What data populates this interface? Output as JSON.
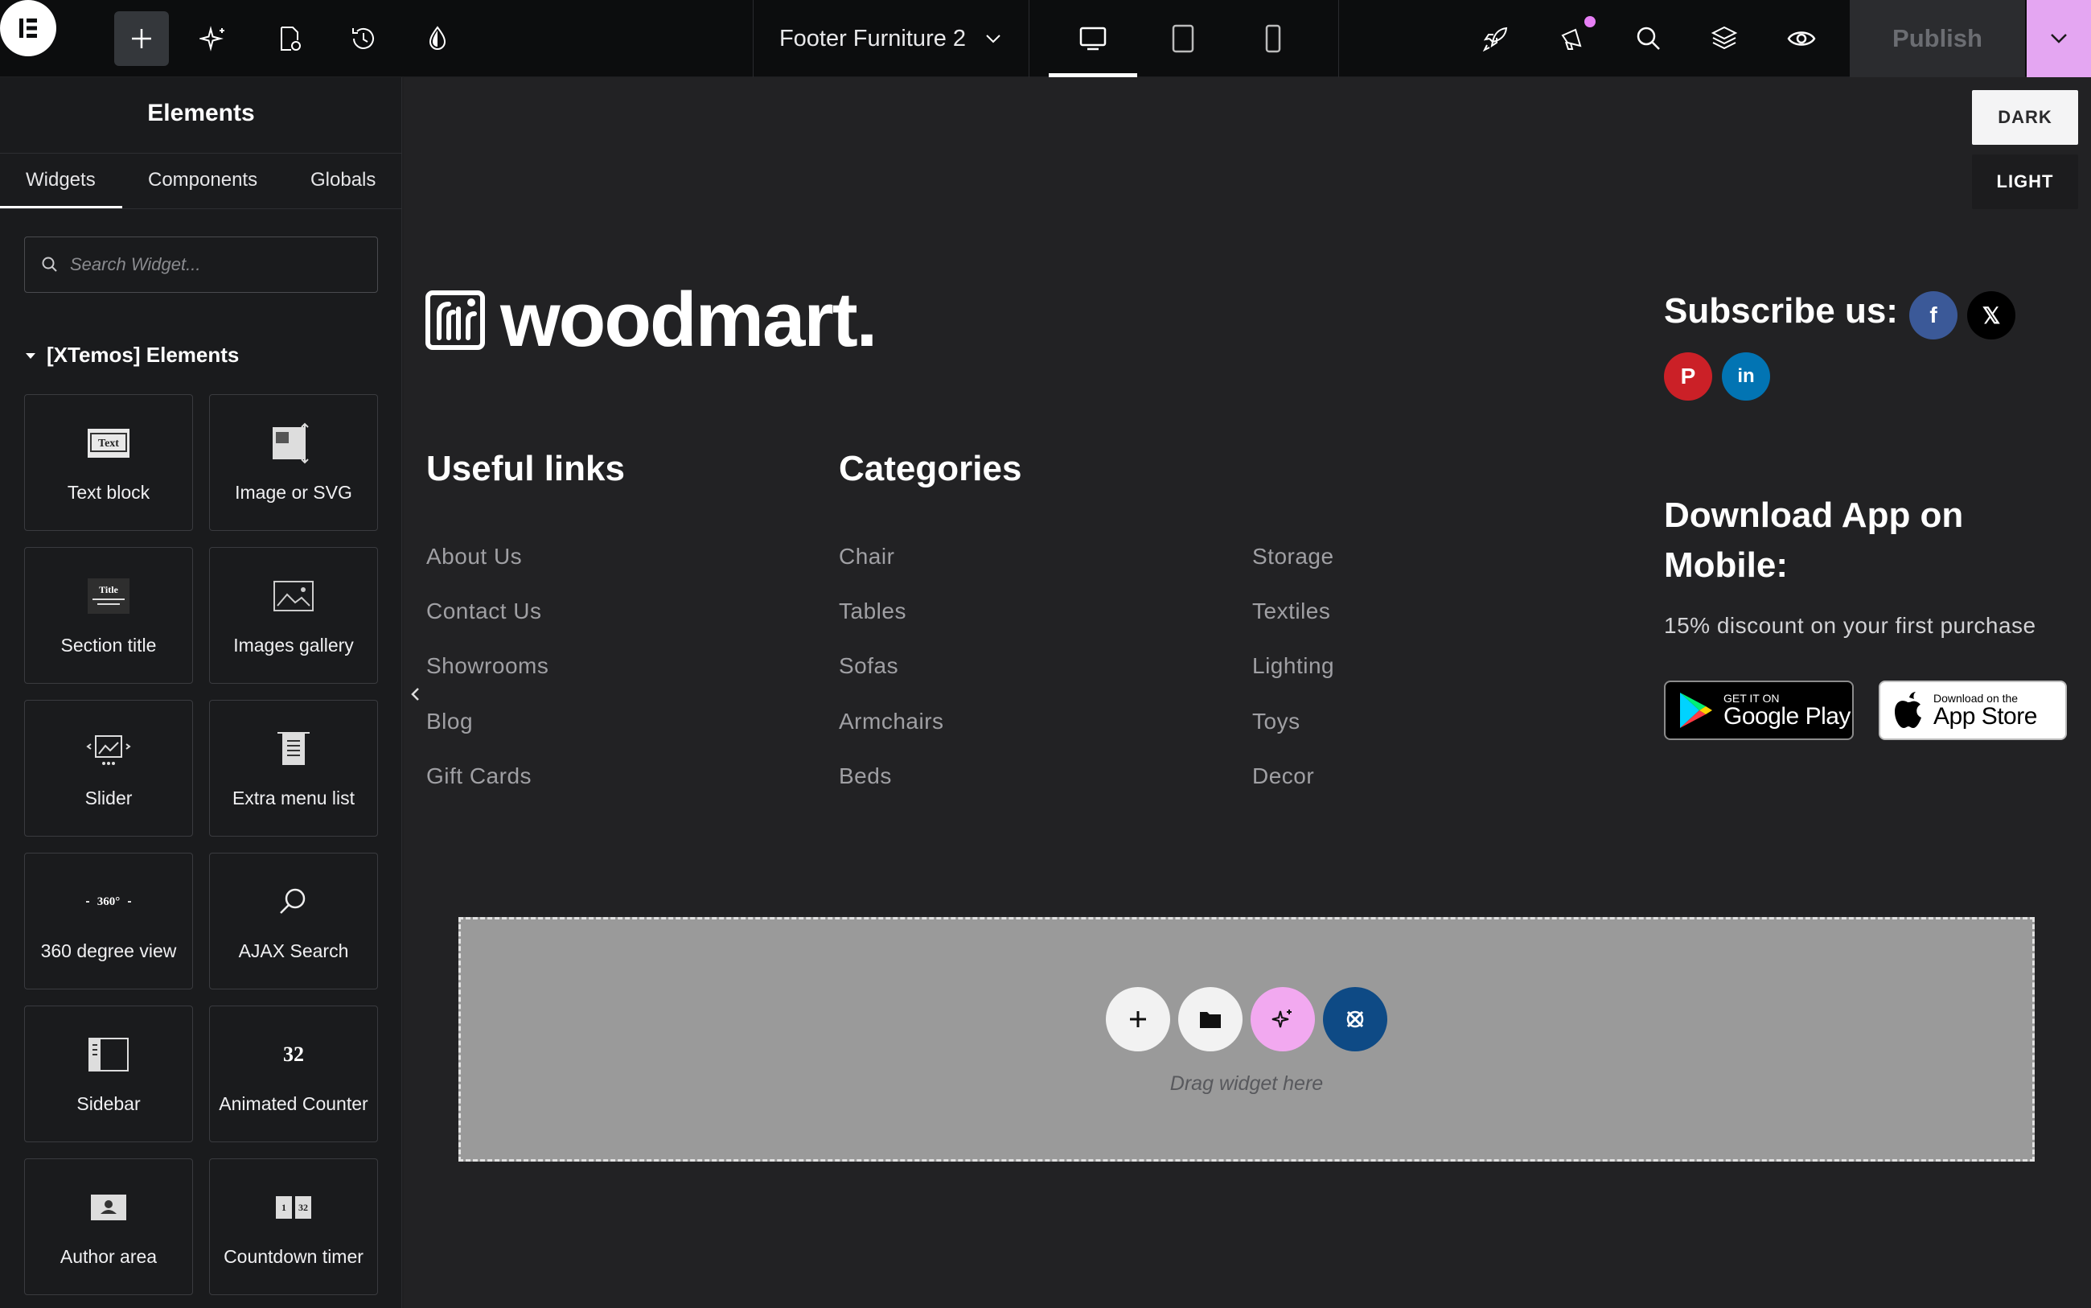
{
  "toolbar": {
    "doc_title": "Footer Furniture 2",
    "publish_label": "Publish",
    "icons": [
      "elementor-logo-icon",
      "plus-icon",
      "ai-sparkle-icon",
      "page-settings-icon",
      "history-icon",
      "site-settings-icon",
      "desktop-icon",
      "tablet-icon",
      "mobile-icon",
      "rocket-icon",
      "announcement-icon",
      "search-icon",
      "structure-icon",
      "preview-eye-icon",
      "chevron-down-icon"
    ],
    "accent_color": "#e4a6f2"
  },
  "panel": {
    "title": "Elements",
    "tabs": [
      "Widgets",
      "Components",
      "Globals"
    ],
    "active_tab": "Widgets",
    "search_placeholder": "Search Widget...",
    "category": "[XTemos] Elements",
    "widgets": [
      {
        "label": "Text block",
        "icon": "text-block-icon"
      },
      {
        "label": "Image or SVG",
        "icon": "image-svg-icon"
      },
      {
        "label": "Section title",
        "icon": "section-title-icon"
      },
      {
        "label": "Images gallery",
        "icon": "images-gallery-icon"
      },
      {
        "label": "Slider",
        "icon": "slider-icon"
      },
      {
        "label": "Extra menu list",
        "icon": "extra-menu-list-icon"
      },
      {
        "label": "360 degree view",
        "icon": "360-view-icon"
      },
      {
        "label": "AJAX Search",
        "icon": "ajax-search-icon"
      },
      {
        "label": "Sidebar",
        "icon": "sidebar-icon"
      },
      {
        "label": "Animated Counter",
        "icon": "animated-counter-icon"
      },
      {
        "label": "Author area",
        "icon": "author-area-icon"
      },
      {
        "label": "Countdown timer",
        "icon": "countdown-timer-icon"
      }
    ],
    "icon_texts": {
      "text": "Text",
      "title": "Title",
      "deg": "360°",
      "count": "32",
      "cd1": "1",
      "cd2": "32"
    }
  },
  "canvas": {
    "modes": [
      "DARK",
      "LIGHT"
    ],
    "brand": "woodmart.",
    "useful_links": {
      "heading": "Useful links",
      "items": [
        "About Us",
        "Contact Us",
        "Showrooms",
        "Blog",
        "Gift Cards"
      ]
    },
    "categories": {
      "heading": "Categories",
      "col1": [
        "Chair",
        "Tables",
        "Sofas",
        "Armchairs",
        "Beds"
      ],
      "col2": [
        "Storage",
        "Textiles",
        "Lighting",
        "Toys",
        "Decor"
      ]
    },
    "subscribe": {
      "heading": "Subscribe us:",
      "socials": [
        {
          "name": "facebook",
          "glyph": "f",
          "color": "#3b5998"
        },
        {
          "name": "x-twitter",
          "glyph": "𝕏",
          "color": "#000000"
        },
        {
          "name": "pinterest",
          "glyph": "P",
          "color": "#cb2027"
        },
        {
          "name": "linkedin",
          "glyph": "in",
          "color": "#0274b3"
        }
      ]
    },
    "download": {
      "heading": "Download App on Mobile:",
      "subtext": "15% discount on your first purchase",
      "google_small": "GET IT ON",
      "google_big": "Google Play",
      "apple_small": "Download on the",
      "apple_big": "App Store"
    },
    "dropzone": {
      "hint": "Drag widget here",
      "buttons": [
        "add-section-button",
        "template-library-button",
        "ai-button",
        "kit-button"
      ]
    }
  }
}
